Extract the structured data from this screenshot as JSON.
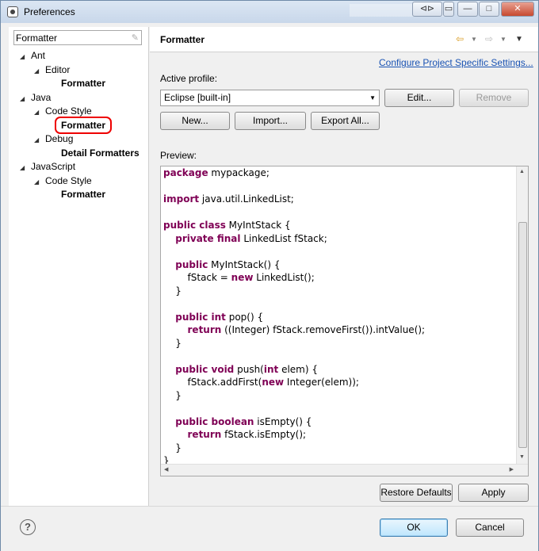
{
  "window": {
    "title": "Preferences",
    "controls": [
      "⊲⊳",
      "▭",
      "—",
      "□",
      "✕"
    ]
  },
  "sidebar": {
    "filter_value": "Formatter",
    "tree": [
      {
        "label": "Ant",
        "level": 0,
        "arrow": "◢",
        "bold": false
      },
      {
        "label": "Editor",
        "level": 1,
        "arrow": "◢",
        "bold": false
      },
      {
        "label": "Formatter",
        "level": 2,
        "arrow": "",
        "bold": true
      },
      {
        "label": "Java",
        "level": 0,
        "arrow": "◢",
        "bold": false
      },
      {
        "label": "Code Style",
        "level": 1,
        "arrow": "◢",
        "bold": false
      },
      {
        "label": "Formatter",
        "level": 2,
        "arrow": "",
        "bold": true,
        "selected": true
      },
      {
        "label": "Debug",
        "level": 1,
        "arrow": "◢",
        "bold": false
      },
      {
        "label": "Detail Formatters",
        "level": 2,
        "arrow": "",
        "bold": true
      },
      {
        "label": "JavaScript",
        "level": 0,
        "arrow": "◢",
        "bold": false
      },
      {
        "label": "Code Style",
        "level": 1,
        "arrow": "◢",
        "bold": false
      },
      {
        "label": "Formatter",
        "level": 2,
        "arrow": "",
        "bold": true
      }
    ]
  },
  "page": {
    "title": "Formatter",
    "configure_link": "Configure Project Specific Settings...",
    "active_profile_label": "Active profile:",
    "profile_value": "Eclipse [built-in]",
    "edit_button": "Edit...",
    "remove_button": "Remove",
    "new_button": "New...",
    "import_button": "Import...",
    "export_button": "Export All...",
    "preview_label": "Preview:",
    "restore_defaults_button": "Restore Defaults",
    "apply_button": "Apply"
  },
  "preview_code": [
    [
      {
        "t": "package",
        "k": 1
      },
      {
        "t": " mypackage;"
      }
    ],
    [],
    [
      {
        "t": "import",
        "k": 1
      },
      {
        "t": " java.util.LinkedList;"
      }
    ],
    [],
    [
      {
        "t": "public class",
        "k": 1
      },
      {
        "t": " MyIntStack {"
      }
    ],
    [
      {
        "t": "    "
      },
      {
        "t": "private final",
        "k": 1
      },
      {
        "t": " LinkedList fStack;"
      }
    ],
    [],
    [
      {
        "t": "    "
      },
      {
        "t": "public",
        "k": 1
      },
      {
        "t": " MyIntStack() {"
      }
    ],
    [
      {
        "t": "        fStack = "
      },
      {
        "t": "new",
        "k": 1
      },
      {
        "t": " LinkedList();"
      }
    ],
    [
      {
        "t": "    }"
      }
    ],
    [],
    [
      {
        "t": "    "
      },
      {
        "t": "public int",
        "k": 1
      },
      {
        "t": " pop() {"
      }
    ],
    [
      {
        "t": "        "
      },
      {
        "t": "return",
        "k": 1
      },
      {
        "t": " ((Integer) fStack.removeFirst()).intValue();"
      }
    ],
    [
      {
        "t": "    }"
      }
    ],
    [],
    [
      {
        "t": "    "
      },
      {
        "t": "public void",
        "k": 1
      },
      {
        "t": " push("
      },
      {
        "t": "int",
        "k": 1
      },
      {
        "t": " elem) {"
      }
    ],
    [
      {
        "t": "        fStack.addFirst("
      },
      {
        "t": "new",
        "k": 1
      },
      {
        "t": " Integer(elem));"
      }
    ],
    [
      {
        "t": "    }"
      }
    ],
    [],
    [
      {
        "t": "    "
      },
      {
        "t": "public boolean",
        "k": 1
      },
      {
        "t": " isEmpty() {"
      }
    ],
    [
      {
        "t": "        "
      },
      {
        "t": "return",
        "k": 1
      },
      {
        "t": " fStack.isEmpty();"
      }
    ],
    [
      {
        "t": "    }"
      }
    ],
    [
      {
        "t": "}"
      }
    ]
  ],
  "footer": {
    "help_icon": "?",
    "ok_button": "OK",
    "cancel_button": "Cancel"
  },
  "colors": {
    "keyword": "#7f0055",
    "link": "#1a53b3",
    "highlight_ring": "#e00000"
  }
}
